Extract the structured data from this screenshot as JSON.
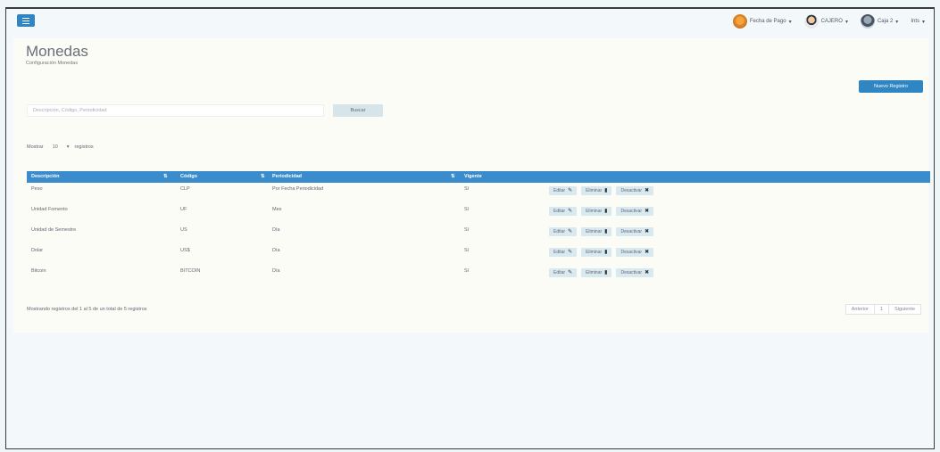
{
  "header": {
    "user_menu": [
      {
        "label": "Fecha de Pago",
        "icon": "cashier-avatar-icon"
      },
      {
        "label": "CAJERO",
        "icon": "user-avatar-icon"
      },
      {
        "label": "Caja 2",
        "icon": "register-avatar-icon"
      },
      {
        "label": "Ints",
        "icon": ""
      }
    ]
  },
  "page": {
    "title": "Monedas",
    "subtitle": "Configuración Monedas",
    "add_button": "Nuevo Registro"
  },
  "search": {
    "placeholder": "Descripción, Código, Periodicidad",
    "button": "Buscar"
  },
  "show": {
    "prefix": "Mostrar",
    "count": "10",
    "suffix": "registros"
  },
  "table": {
    "headers": [
      "Descripción",
      "Código",
      "Periodicidad",
      "Vigente"
    ],
    "rows": [
      {
        "desc": "Peso",
        "code": "CLP",
        "period": "Por Fecha Periodicidad",
        "vig": "Sí"
      },
      {
        "desc": "Unidad Fomento",
        "code": "UF",
        "period": "Mes",
        "vig": "Sí"
      },
      {
        "desc": "Unidad de Semestre",
        "code": "US",
        "period": "Día",
        "vig": "Sí"
      },
      {
        "desc": "Dolar",
        "code": "US$",
        "period": "Día",
        "vig": "Sí"
      },
      {
        "desc": "Bitcoin",
        "code": "BITCOIN",
        "period": "Día",
        "vig": "Sí"
      }
    ],
    "actions": {
      "edit": "Editar",
      "delete": "Eliminar",
      "disable": "Desactivar"
    }
  },
  "footer": {
    "summary": "Mostrando registros del 1 al 5 de un total de 5 registros",
    "prev": "Anterior",
    "page": "1",
    "next": "Siguiente"
  },
  "colors": {
    "accent": "#2f86c2",
    "table_header": "#3a8ccc"
  }
}
